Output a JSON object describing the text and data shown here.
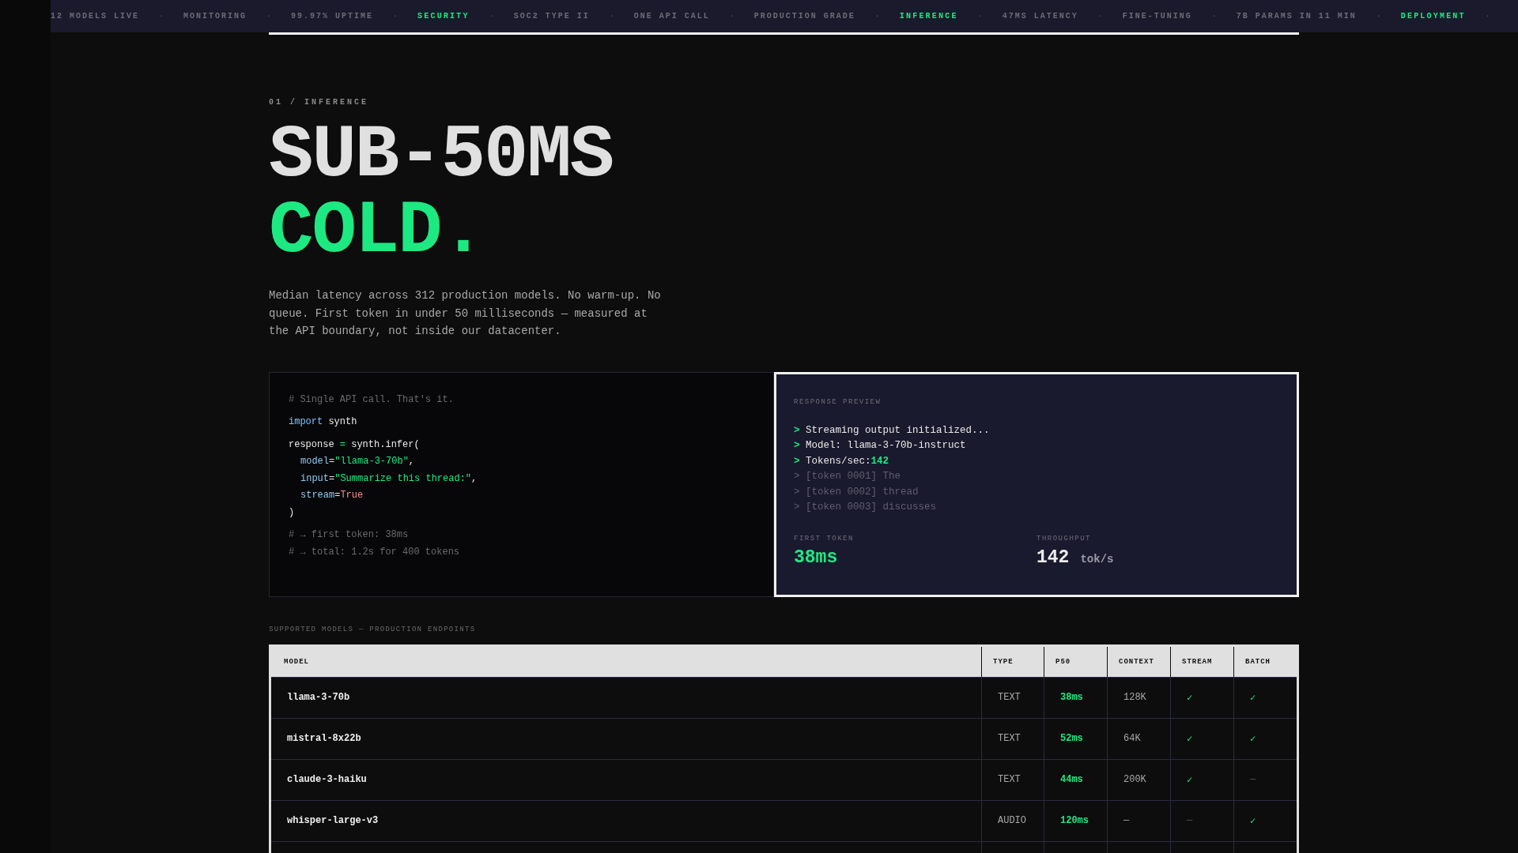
{
  "ticker": [
    {
      "kind": "label",
      "text": "12 MODELS LIVE",
      "highlight": false
    },
    {
      "kind": "sep",
      "text": "·"
    },
    {
      "kind": "label",
      "text": "MONITORING",
      "highlight": false
    },
    {
      "kind": "sep",
      "text": "·"
    },
    {
      "kind": "label",
      "text": "99.97% UPTIME",
      "highlight": false
    },
    {
      "kind": "sep",
      "text": "·"
    },
    {
      "kind": "label",
      "text": "SECURITY",
      "highlight": true
    },
    {
      "kind": "sep",
      "text": "·"
    },
    {
      "kind": "label",
      "text": "SOC2 TYPE II",
      "highlight": false
    },
    {
      "kind": "sep",
      "text": "·"
    },
    {
      "kind": "label",
      "text": "ONE API CALL",
      "highlight": false
    },
    {
      "kind": "sep",
      "text": "·"
    },
    {
      "kind": "label",
      "text": "PRODUCTION GRADE",
      "highlight": false
    },
    {
      "kind": "sep",
      "text": "·"
    },
    {
      "kind": "label",
      "text": "INFERENCE",
      "highlight": true
    },
    {
      "kind": "sep",
      "text": "·"
    },
    {
      "kind": "label",
      "text": "47MS LATENCY",
      "highlight": false
    },
    {
      "kind": "sep",
      "text": "·"
    },
    {
      "kind": "label",
      "text": "FINE-TUNING",
      "highlight": false
    },
    {
      "kind": "sep",
      "text": "·"
    },
    {
      "kind": "label",
      "text": "7B PARAMS IN 11 MIN",
      "highlight": false
    },
    {
      "kind": "sep",
      "text": "·"
    },
    {
      "kind": "label",
      "text": "DEPLOYMENT",
      "highlight": true
    },
    {
      "kind": "sep",
      "text": "·"
    }
  ],
  "hero": {
    "eyebrow": "01 / INFERENCE",
    "headline": "SUB-50MS",
    "headline_accent": "COLD.",
    "description": "Median latency across 312 production models. No warm-up. No queue. First token in under 50 milliseconds — measured at the API boundary, not inside our datacenter."
  },
  "code": {
    "lines": [
      {
        "indent": false,
        "parts": [
          {
            "kind": "comment",
            "t": "# Single API call. That's it."
          }
        ]
      },
      {
        "indent": false,
        "parts": [
          {
            "kind": "kw",
            "t": "import"
          },
          {
            "kind": "plain",
            "t": " synth"
          }
        ]
      },
      {
        "indent": false,
        "parts": [
          {
            "kind": "plain",
            "t": "response "
          },
          {
            "kind": "op",
            "t": "="
          },
          {
            "kind": "plain",
            "t": " synth.infer("
          }
        ]
      },
      {
        "indent": true,
        "parts": [
          {
            "kind": "param",
            "t": "model"
          },
          {
            "kind": "plain",
            "t": "="
          },
          {
            "kind": "str",
            "t": "\"llama-3-70b\""
          },
          {
            "kind": "plain",
            "t": ","
          }
        ]
      },
      {
        "indent": true,
        "parts": [
          {
            "kind": "param",
            "t": "input"
          },
          {
            "kind": "plain",
            "t": "="
          },
          {
            "kind": "str",
            "t": "\"Summarize this thread:\""
          },
          {
            "kind": "plain",
            "t": ","
          }
        ]
      },
      {
        "indent": true,
        "parts": [
          {
            "kind": "param",
            "t": "stream"
          },
          {
            "kind": "plain",
            "t": "="
          },
          {
            "kind": "bool",
            "t": "True"
          }
        ]
      },
      {
        "indent": false,
        "parts": [
          {
            "kind": "plain",
            "t": ")"
          }
        ]
      },
      {
        "indent": false,
        "parts": [
          {
            "kind": "comment",
            "t": "# → first token: 38ms"
          }
        ]
      },
      {
        "indent": false,
        "parts": [
          {
            "kind": "comment",
            "t": "# → total: 1.2s for 400 tokens"
          }
        ]
      }
    ]
  },
  "preview": {
    "title": "RESPONSE PREVIEW",
    "lines": [
      {
        "active": true,
        "prompt": ">",
        "text": "Streaming output initialized..."
      },
      {
        "active": true,
        "prompt": ">",
        "text": "Model: llama-3-70b-instruct"
      },
      {
        "active": true,
        "prompt": ">",
        "text": "Tokens/sec:",
        "value": "142"
      },
      {
        "active": false,
        "prompt": ">",
        "text": "[token 0001] The"
      },
      {
        "active": false,
        "prompt": ">",
        "text": "[token 0002] thread"
      },
      {
        "active": false,
        "prompt": ">",
        "text": "[token 0003] discusses"
      }
    ],
    "stats": [
      {
        "label": "FIRST TOKEN",
        "value": "38ms",
        "accent": true
      },
      {
        "label": "THROUGHPUT",
        "value": "142",
        "unit": "tok/s",
        "accent": false
      }
    ]
  },
  "table": {
    "caption": "SUPPORTED MODELS — PRODUCTION ENDPOINTS",
    "columns": [
      "MODEL",
      "TYPE",
      "P50",
      "CONTEXT",
      "STREAM",
      "BATCH"
    ],
    "rows": [
      {
        "model": "llama-3-70b",
        "type": "TEXT",
        "p50": "38ms",
        "context": "128K",
        "stream": {
          "text": "✓",
          "on": true
        },
        "batch": {
          "text": "✓",
          "on": true
        }
      },
      {
        "model": "mistral-8x22b",
        "type": "TEXT",
        "p50": "52ms",
        "context": "64K",
        "stream": {
          "text": "✓",
          "on": true
        },
        "batch": {
          "text": "✓",
          "on": true
        }
      },
      {
        "model": "claude-3-haiku",
        "type": "TEXT",
        "p50": "44ms",
        "context": "200K",
        "stream": {
          "text": "✓",
          "on": true
        },
        "batch": {
          "text": "—",
          "on": false
        }
      },
      {
        "model": "whisper-large-v3",
        "type": "AUDIO",
        "p50": "120ms",
        "context": "—",
        "stream": {
          "text": "—",
          "on": false
        },
        "batch": {
          "text": "✓",
          "on": true
        }
      }
    ]
  }
}
